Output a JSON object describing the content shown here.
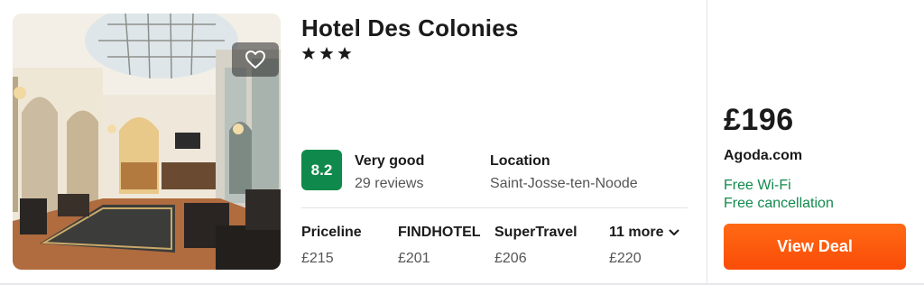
{
  "hotel": {
    "name": "Hotel Des Colonies",
    "star_rating": 3,
    "star_glyphs": [
      "★",
      "★",
      "★"
    ],
    "favorite_icon": "heart-outline-icon"
  },
  "rating": {
    "score": "8.2",
    "label": "Very good",
    "reviews": "29 reviews",
    "badge_color": "#108a4c"
  },
  "location": {
    "label": "Location",
    "value": "Saint-Josse-ten-Noode"
  },
  "providers": [
    {
      "name": "Priceline",
      "price": "£215"
    },
    {
      "name": "FINDHOTEL",
      "price": "£201"
    },
    {
      "name": "SuperTravel",
      "price": "£206"
    },
    {
      "name": "11 more",
      "price": "£220",
      "icon": "chevron-down-icon"
    }
  ],
  "deal": {
    "price": "£196",
    "site": "Agoda.com",
    "features": [
      "Free Wi-Fi",
      "Free cancellation"
    ],
    "feature_color": "#108a4c",
    "button_label": "View Deal",
    "button_color": "#ff5b0f"
  }
}
